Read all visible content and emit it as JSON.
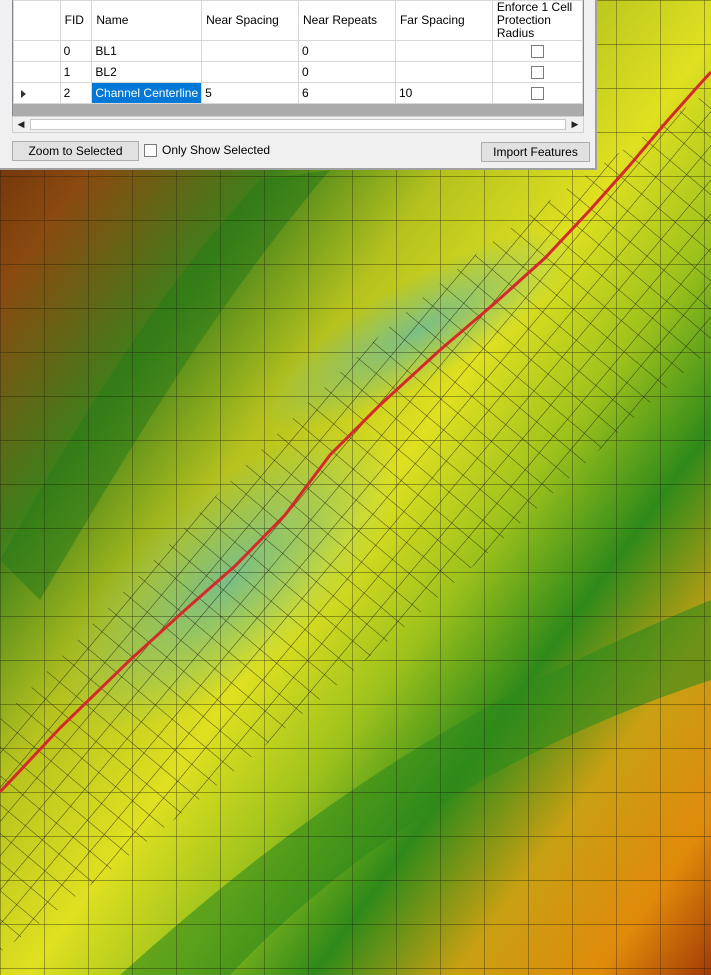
{
  "grid": {
    "columns": [
      "FID",
      "Name",
      "Near Spacing",
      "Near Repeats",
      "Far Spacing",
      "Enforce 1 Cell Protection Radius"
    ],
    "rows": [
      {
        "fid": "0",
        "name": "BL1",
        "near_spacing": "",
        "near_repeats": "0",
        "far_spacing": "",
        "enforce": false
      },
      {
        "fid": "1",
        "name": "BL2",
        "near_spacing": "",
        "near_repeats": "0",
        "far_spacing": "",
        "enforce": false
      },
      {
        "fid": "2",
        "name": "Channel Centerline",
        "near_spacing": "5",
        "near_repeats": "6",
        "far_spacing": "10",
        "enforce": false,
        "current": true
      }
    ]
  },
  "toolbar": {
    "zoom_label": "Zoom to Selected",
    "only_show_label": "Only Show Selected",
    "import_label": "Import Features"
  },
  "map": {
    "centerline_color": "#d42a2a",
    "mesh_color": "#1a1a0a"
  }
}
